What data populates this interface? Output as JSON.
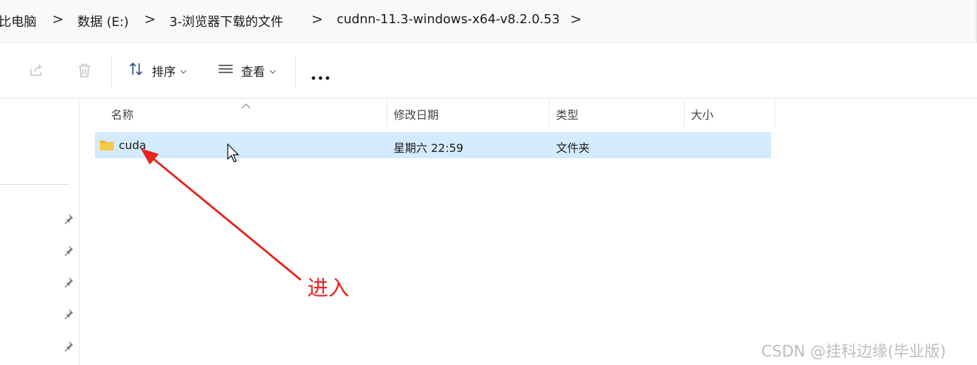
{
  "address_bar": {
    "crumbs": [
      "比电脑",
      "数据 (E:)",
      "3-浏览器下载的文件",
      "cudnn-11.3-windows-x64-v8.2.0.53"
    ],
    "separator": ">"
  },
  "toolbar": {
    "sort_label": "排序",
    "view_label": "查看",
    "more_label": "•••"
  },
  "columns": {
    "name": "名称",
    "modified": "修改日期",
    "type": "类型",
    "size": "大小"
  },
  "files": [
    {
      "name": "cuda",
      "modified": "星期六 22:59",
      "type": "文件夹",
      "size": ""
    }
  ],
  "annotation": {
    "text": "进入",
    "color": "#e8241f"
  },
  "watermark": "CSDN @挂科边缘(毕业版)",
  "colors": {
    "selection": "#cce8ff",
    "folder": "#f7c948"
  },
  "icons": [
    "share-icon",
    "delete-icon",
    "sort-icon",
    "view-list-icon",
    "chevron-down-icon",
    "more-icon",
    "pin-icon",
    "folder-icon",
    "cursor-icon"
  ]
}
